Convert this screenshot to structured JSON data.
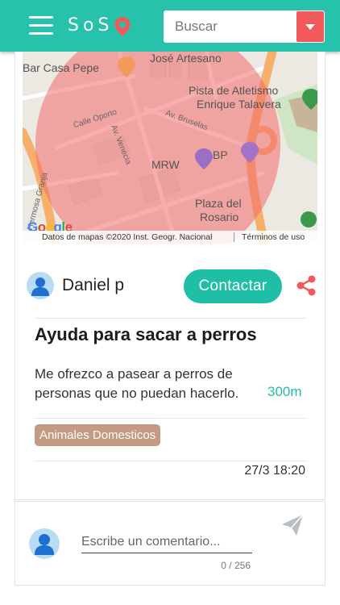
{
  "header": {
    "brand": "SoS",
    "search_placeholder": "Buscar",
    "colors": {
      "bar": "#26c2ab",
      "dropdown": "#f05a5a"
    },
    "icons": [
      "menu-icon",
      "location-pin-icon",
      "chevron-down-icon"
    ]
  },
  "map": {
    "labels": {
      "bar_casa_pepe": "Bar Casa Pepe",
      "jose_artesano": "José Artesano",
      "pista_line1": "Pista de Atletismo",
      "pista_line2": "Enrique Talavera",
      "calle_oporto": "Calle Oporto",
      "av_bruselas": "Av. Bruselas",
      "av_venecia": "Av. Venecia",
      "mrw": "MRW",
      "bp": "BP",
      "plaza_line1": "Plaza del",
      "plaza_line2": "Rosario",
      "granja": "Hermosa Granja",
      "google": "Google"
    },
    "attribution": "Datos de mapas ©2020 Inst. Geogr. Nacional",
    "terms": "Términos de uso",
    "colors": {
      "radius_circle": "#f28b8b",
      "roads": "#f6b06a"
    }
  },
  "post": {
    "user": {
      "name": "Daniel p",
      "icon": "user-icon"
    },
    "contact_label": "Contactar",
    "share_icon": "share-icon",
    "title": "Ayuda para sacar a perros",
    "description": "Me ofrezco a pasear a perros de personas que no puedan hacerlo.",
    "distance": "300m",
    "category": "Animales Domesticos",
    "date": "27/3 18:20",
    "colors": {
      "accent": "#1fbfa6",
      "tag": "#c49a83"
    }
  },
  "comment": {
    "placeholder": "Escribe un comentario...",
    "counter": "0 / 256",
    "send_icon": "send-icon"
  }
}
